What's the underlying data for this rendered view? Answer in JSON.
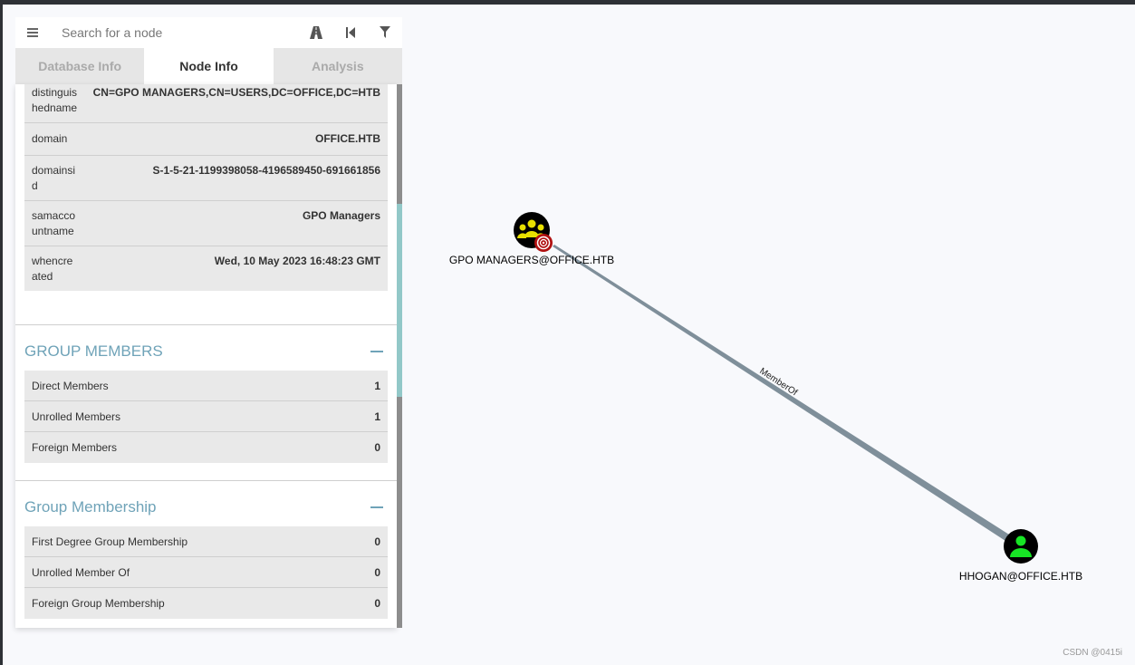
{
  "search": {
    "placeholder": "Search for a node"
  },
  "tabs": [
    {
      "label": "Database Info"
    },
    {
      "label": "Node Info"
    },
    {
      "label": "Analysis"
    }
  ],
  "properties": [
    {
      "key": "distinguishedname",
      "value": "CN=GPO MANAGERS,CN=USERS,DC=OFFICE,DC=HTB"
    },
    {
      "key": "domain",
      "value": "OFFICE.HTB"
    },
    {
      "key": "domainsid",
      "value": "S-1-5-21-1199398058-4196589450-691661856"
    },
    {
      "key": "samaccountname",
      "value": "GPO Managers"
    },
    {
      "key": "whencreated",
      "value": "Wed, 10 May 2023 16:48:23 GMT"
    }
  ],
  "group_members": {
    "title": "GROUP MEMBERS",
    "rows": [
      {
        "label": "Direct Members",
        "value": "1"
      },
      {
        "label": "Unrolled Members",
        "value": "1"
      },
      {
        "label": "Foreign Members",
        "value": "0"
      }
    ]
  },
  "group_membership": {
    "title": "Group Membership",
    "rows": [
      {
        "label": "First Degree Group Membership",
        "value": "0"
      },
      {
        "label": "Unrolled Member Of",
        "value": "0"
      },
      {
        "label": "Foreign Group Membership",
        "value": "0"
      }
    ]
  },
  "graph": {
    "group_node": {
      "label": "GPO MANAGERS@OFFICE.HTB",
      "color": "#e8e000"
    },
    "user_node": {
      "label": "HHOGAN@OFFICE.HTB",
      "color": "#17e625"
    },
    "edge": {
      "label": "MemberOf",
      "color": "#7a8c98"
    }
  },
  "watermark": "CSDN @0415i"
}
